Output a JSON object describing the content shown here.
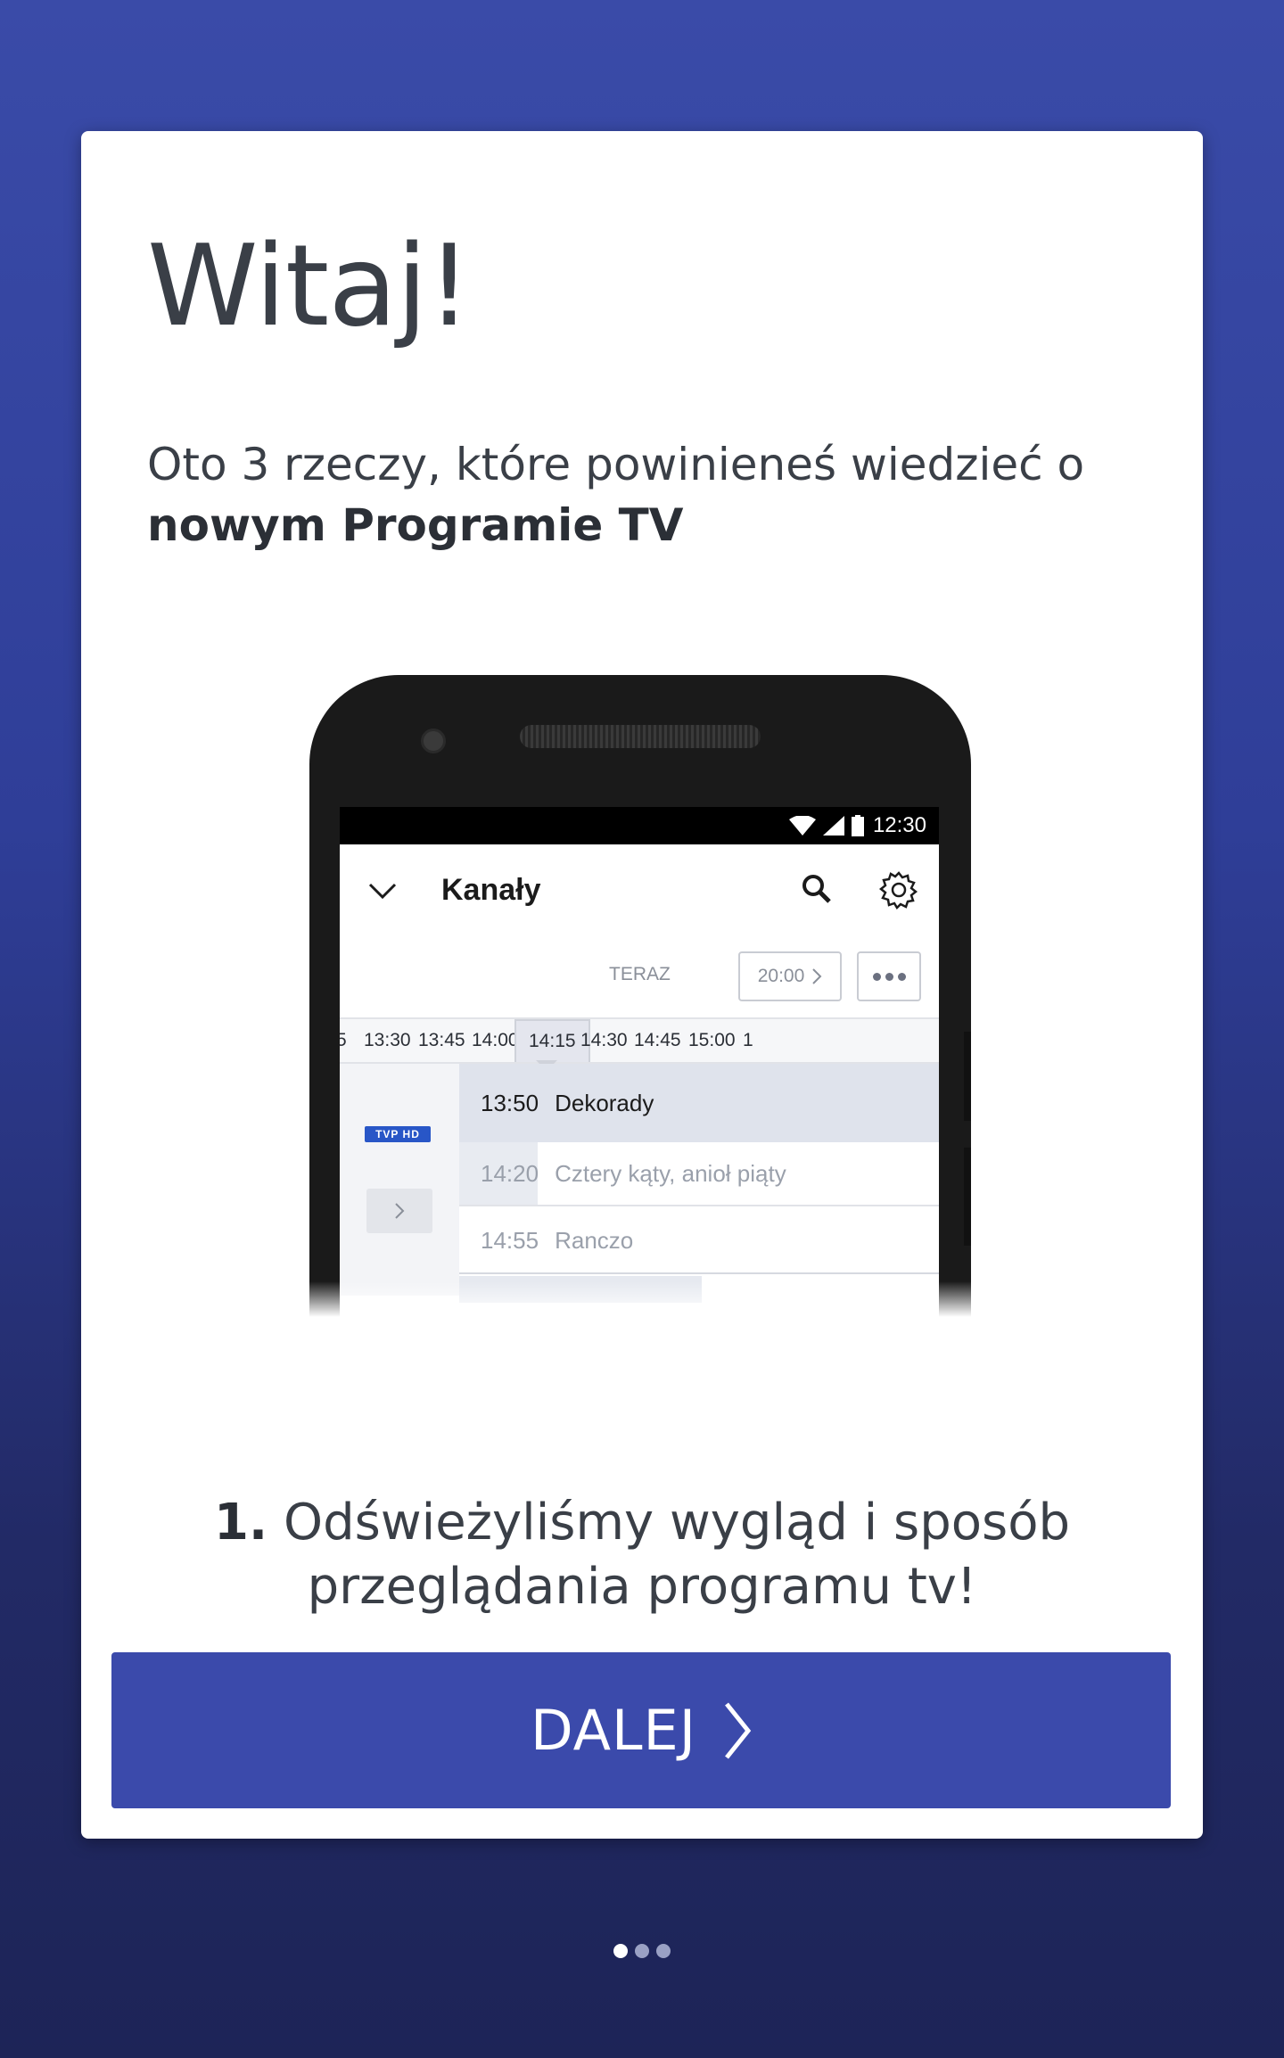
{
  "card": {
    "title": "Witaj!",
    "subtitle_line1": "Oto 3 rzeczy, które powinieneś wiedzieć o",
    "subtitle_bold": "nowym Programie TV"
  },
  "illustration": {
    "status_time": "12:30",
    "app_title": "Kanały",
    "teraz_label": "TERAZ",
    "time_button": "20:00",
    "timeline_ticks": [
      "5",
      "13:30",
      "13:45",
      "14:00",
      "14:15",
      "14:30",
      "14:45",
      "15:00",
      "1"
    ],
    "active_tick": "14:15",
    "channel_logo": "TVP HD",
    "programs": [
      {
        "time": "13:50",
        "title": "Dekorady"
      },
      {
        "time": "14:20",
        "title": "Cztery kąty, anioł piąty"
      },
      {
        "time": "14:55",
        "title": "Ranczo"
      }
    ]
  },
  "step": {
    "number": "1.",
    "text": "Odświeżyliśmy wygląd i sposób przeglądania programu tv!"
  },
  "button": {
    "label": "DALEJ"
  },
  "pager": {
    "total": 3,
    "active_index": 0
  },
  "colors": {
    "background_top": "#3a4ba8",
    "background_bottom": "#1d2457",
    "button": "#3b4aab",
    "title_text": "#3a3f47"
  },
  "icons": {
    "button_icon": "chevron-right-icon",
    "appbar_left": "chevron-down-icon",
    "appbar_search": "search-icon",
    "appbar_settings": "gear-icon"
  }
}
